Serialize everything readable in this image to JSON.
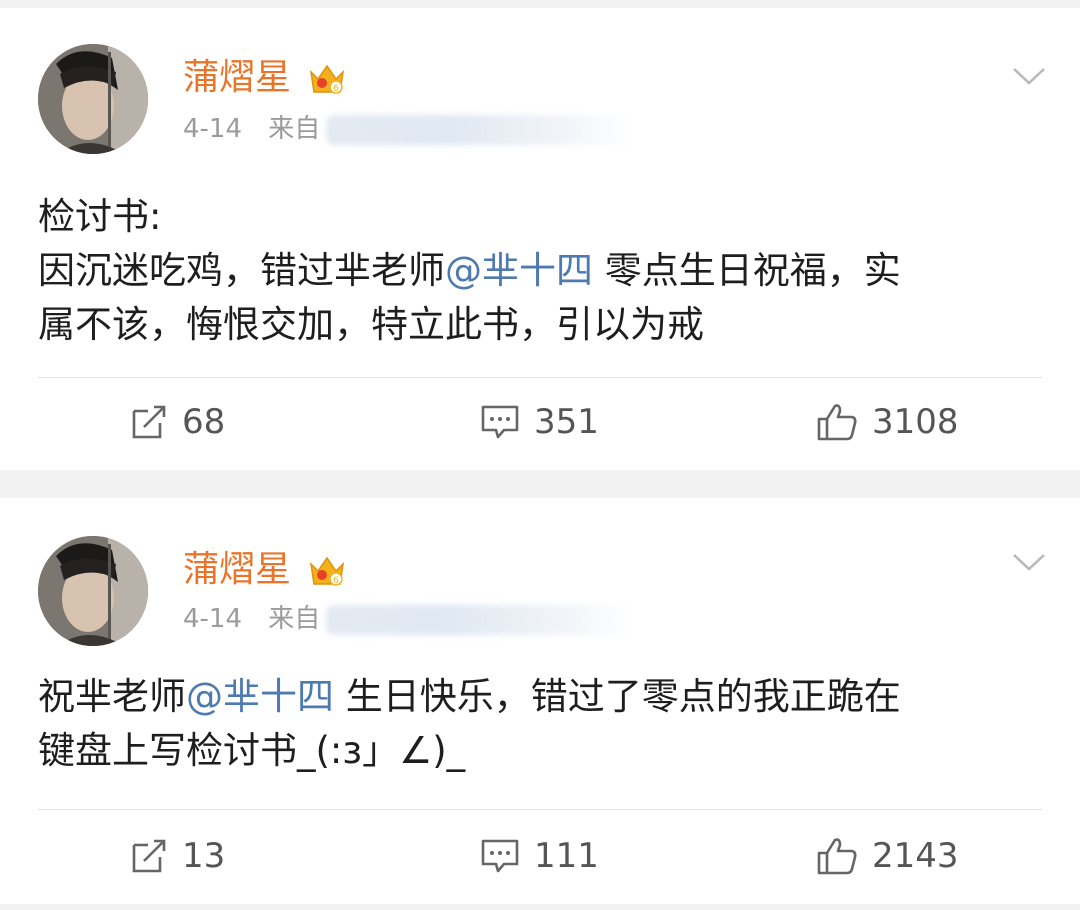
{
  "posts": [
    {
      "username": "蒲熠星",
      "date": "4-14",
      "source_prefix": "来自",
      "text_lines": [
        [
          {
            "t": "检讨书:"
          }
        ],
        [
          {
            "t": "因沉迷吃鸡，错过芈老师"
          },
          {
            "t": "@芈十四",
            "mention": true
          },
          {
            "t": " 零点生日祝福，实"
          }
        ],
        [
          {
            "t": "属不该，悔恨交加，特立此书，引以为戒"
          }
        ]
      ],
      "reposts": "68",
      "comments": "351",
      "likes": "3108"
    },
    {
      "username": "蒲熠星",
      "date": "4-14",
      "source_prefix": "来自",
      "text_lines": [
        [
          {
            "t": "祝芈老师"
          },
          {
            "t": "@芈十四",
            "mention": true
          },
          {
            "t": " 生日快乐，错过了零点的我正跪在"
          }
        ],
        [
          {
            "t": "键盘上写检讨书_(:з」∠)_"
          }
        ]
      ],
      "reposts": "13",
      "comments": "111",
      "likes": "2143"
    }
  ],
  "colors": {
    "username": "#e8762a",
    "mention": "#4e7ab0",
    "meta": "#9b9b9b",
    "text": "#1e1e1e"
  },
  "icons": [
    "avatar",
    "vip-crown-icon",
    "chevron-down-icon",
    "repost-icon",
    "comment-icon",
    "like-icon"
  ]
}
